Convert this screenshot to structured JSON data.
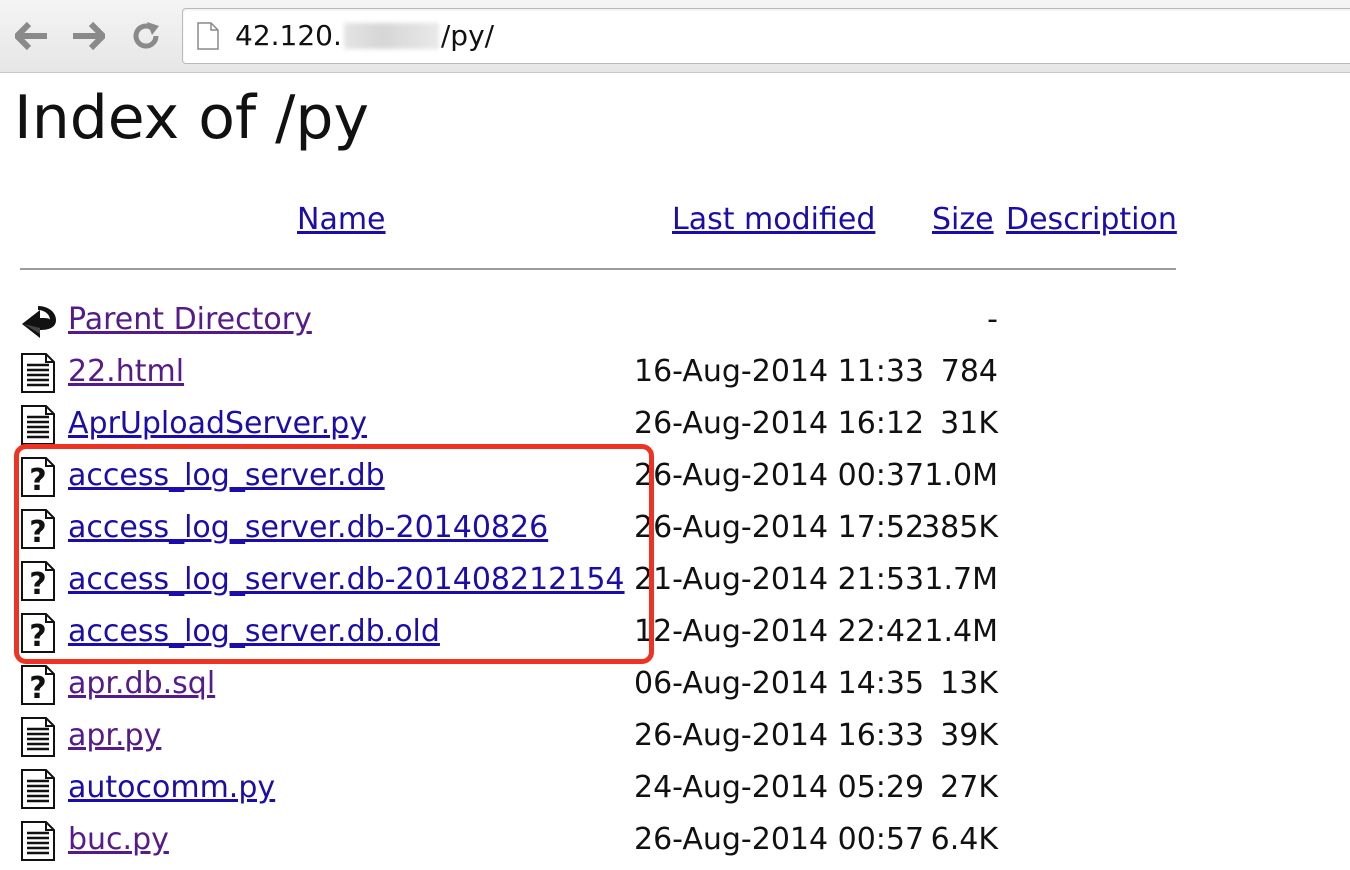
{
  "browser": {
    "url_prefix": "42.120.",
    "url_suffix": "/py/"
  },
  "page": {
    "title": "Index of /py",
    "columns": {
      "name": "Name",
      "last_modified": "Last modified",
      "size": "Size",
      "description": "Description"
    }
  },
  "entries": [
    {
      "name": "Parent Directory",
      "date": "",
      "size": "-",
      "icon": "back-icon",
      "visited": true
    },
    {
      "name": "22.html",
      "date": "16-Aug-2014 11:33",
      "size": "784",
      "icon": "text-file-icon",
      "visited": true
    },
    {
      "name": "AprUploadServer.py",
      "date": "26-Aug-2014 16:12",
      "size": "31K",
      "icon": "text-file-icon",
      "visited": false
    },
    {
      "name": "access_log_server.db",
      "date": "26-Aug-2014 00:37",
      "size": "1.0M",
      "icon": "unknown-file-icon",
      "visited": false
    },
    {
      "name": "access_log_server.db-20140826",
      "date": "26-Aug-2014 17:52",
      "size": "385K",
      "icon": "unknown-file-icon",
      "visited": false
    },
    {
      "name": "access_log_server.db-201408212154",
      "date": "21-Aug-2014 21:53",
      "size": "1.7M",
      "icon": "unknown-file-icon",
      "visited": false
    },
    {
      "name": "access_log_server.db.old",
      "date": "12-Aug-2014 22:42",
      "size": "1.4M",
      "icon": "unknown-file-icon",
      "visited": false
    },
    {
      "name": "apr.db.sql",
      "date": "06-Aug-2014 14:35",
      "size": "13K",
      "icon": "unknown-file-icon",
      "visited": true
    },
    {
      "name": "apr.py",
      "date": "26-Aug-2014 16:33",
      "size": "39K",
      "icon": "text-file-icon",
      "visited": true
    },
    {
      "name": "autocomm.py",
      "date": "24-Aug-2014 05:29",
      "size": "27K",
      "icon": "text-file-icon",
      "visited": false
    },
    {
      "name": "buc.py",
      "date": "26-Aug-2014 00:57",
      "size": "6.4K",
      "icon": "text-file-icon",
      "visited": true
    }
  ],
  "colors": {
    "link": "#1a0dab",
    "visited_link": "#551a8b",
    "highlight_box": "#ee3322"
  }
}
